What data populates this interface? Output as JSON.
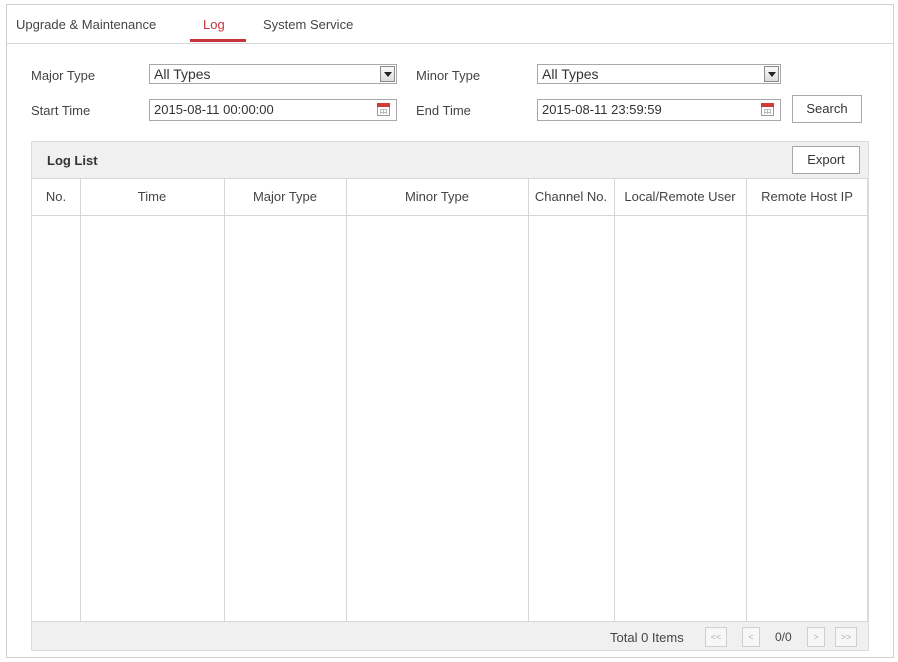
{
  "tabs": [
    {
      "label": "Upgrade & Maintenance",
      "active": false
    },
    {
      "label": "Log",
      "active": true
    },
    {
      "label": "System Service",
      "active": false
    }
  ],
  "filters": {
    "major_type_label": "Major Type",
    "major_type_value": "All Types",
    "minor_type_label": "Minor Type",
    "minor_type_value": "All Types",
    "start_time_label": "Start Time",
    "start_time_value": "2015-08-11 00:00:00",
    "end_time_label": "End Time",
    "end_time_value": "2015-08-11 23:59:59",
    "search_label": "Search"
  },
  "log_list": {
    "title": "Log List",
    "export_label": "Export",
    "columns": [
      "No.",
      "Time",
      "Major Type",
      "Minor Type",
      "Channel No.",
      "Local/Remote User",
      "Remote Host IP"
    ],
    "rows": []
  },
  "pagination": {
    "total_text": "Total 0 Items",
    "first_label": "<<",
    "prev_label": "<",
    "page_text": "0/0",
    "next_label": ">",
    "last_label": ">>"
  },
  "colors": {
    "accent": "#c6353a",
    "panel_bg": "#f0f0f0",
    "border": "#d6d6d6"
  }
}
